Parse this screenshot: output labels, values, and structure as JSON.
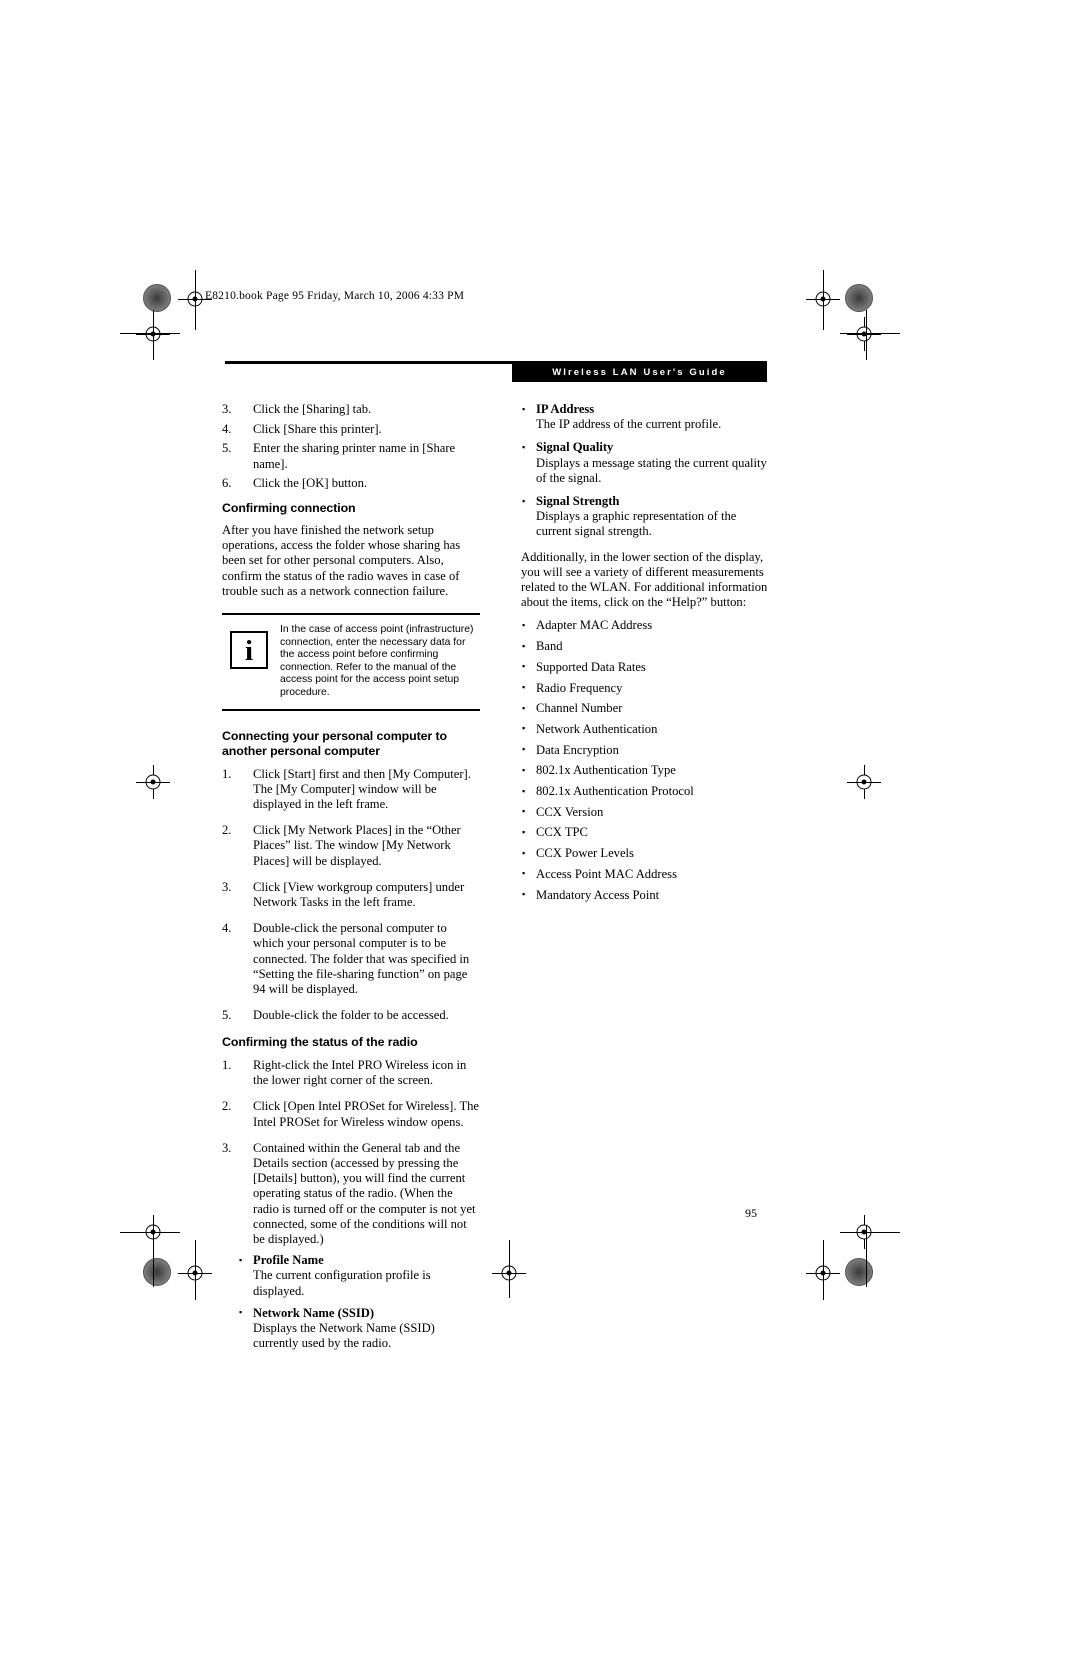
{
  "slug": "E8210.book  Page 95  Friday, March 10, 2006  4:33 PM",
  "running_head": "WIreless LAN User's Guide",
  "page_number": "95",
  "left_column": {
    "steps_top": [
      {
        "num": "3.",
        "text": "Click the [Sharing] tab."
      },
      {
        "num": "4.",
        "text": "Click [Share this printer]."
      },
      {
        "num": "5.",
        "text": "Enter the sharing printer name in [Share name]."
      },
      {
        "num": "6.",
        "text": "Click the [OK] button."
      }
    ],
    "heading_confirming_connection": "Confirming connection",
    "confirming_connection_body": "After you have finished the network setup operations, access the folder whose sharing has been set for other personal computers. Also, confirm the status of the radio waves in case of trouble such as a network connection failure.",
    "note": {
      "icon": "i",
      "text": "In the case of access point (infrastructure) connection, enter the necessary data for the access point before confirming connection. Refer to the manual of the access point for the access point setup procedure."
    },
    "heading_connecting": "Connecting your personal computer to another personal computer",
    "steps_connecting": [
      {
        "num": "1.",
        "text": "Click [Start] first and then [My Computer]. The [My Computer] window will be displayed in the left frame."
      },
      {
        "num": "2.",
        "text": "Click [My Network Places] in the “Other Places” list. The window [My Network Places] will be displayed."
      },
      {
        "num": "3.",
        "text": "Click [View workgroup computers] under Network Tasks in the left frame."
      },
      {
        "num": "4.",
        "text": "Double-click the personal computer to which your personal computer is to be connected. The folder that was specified in “Setting the file-sharing function” on page 94 will be displayed."
      },
      {
        "num": "5.",
        "text": "Double-click the folder to be accessed."
      }
    ],
    "heading_status": "Confirming the status of the radio",
    "steps_status": [
      {
        "num": "1.",
        "text": "Right-click the Intel PRO Wireless icon in the lower right corner of the screen."
      },
      {
        "num": "2.",
        "text": "Click [Open Intel PROSet for Wireless]. The Intel PROSet for Wireless window opens."
      },
      {
        "num": "3.",
        "text": "Contained within the General tab and the Details section (accessed by pressing the [Details] button), you will find the current operating status of the radio. (When the radio is turned off or the computer is not yet connected, some of the conditions will not be displayed.)"
      }
    ],
    "definitions": [
      {
        "term": "Profile Name",
        "desc": "The current configuration profile is displayed."
      },
      {
        "term": "Network Name (SSID)",
        "desc": "Displays the Network Name (SSID) currently used by the radio."
      }
    ]
  },
  "right_column": {
    "definitions": [
      {
        "term": "IP Address",
        "desc": "The IP address of the current profile."
      },
      {
        "term": "Signal Quality",
        "desc": "Displays a message stating the current quality of the signal."
      },
      {
        "term": "Signal Strength",
        "desc": "Displays a graphic representation of the current signal strength."
      }
    ],
    "paragraph": "Additionally, in the lower section of the display, you will see a variety of different measurements related to the WLAN. For additional information about the items, click on the “Help?” button:",
    "items": [
      "Adapter MAC Address",
      "Band",
      "Supported Data Rates",
      "Radio Frequency",
      "Channel Number",
      "Network Authentication",
      "Data Encryption",
      "802.1x Authentication Type",
      "802.1x Authentication Protocol",
      "CCX Version",
      "CCX TPC",
      "CCX Power Levels",
      "Access Point MAC Address",
      "Mandatory Access Point"
    ]
  }
}
